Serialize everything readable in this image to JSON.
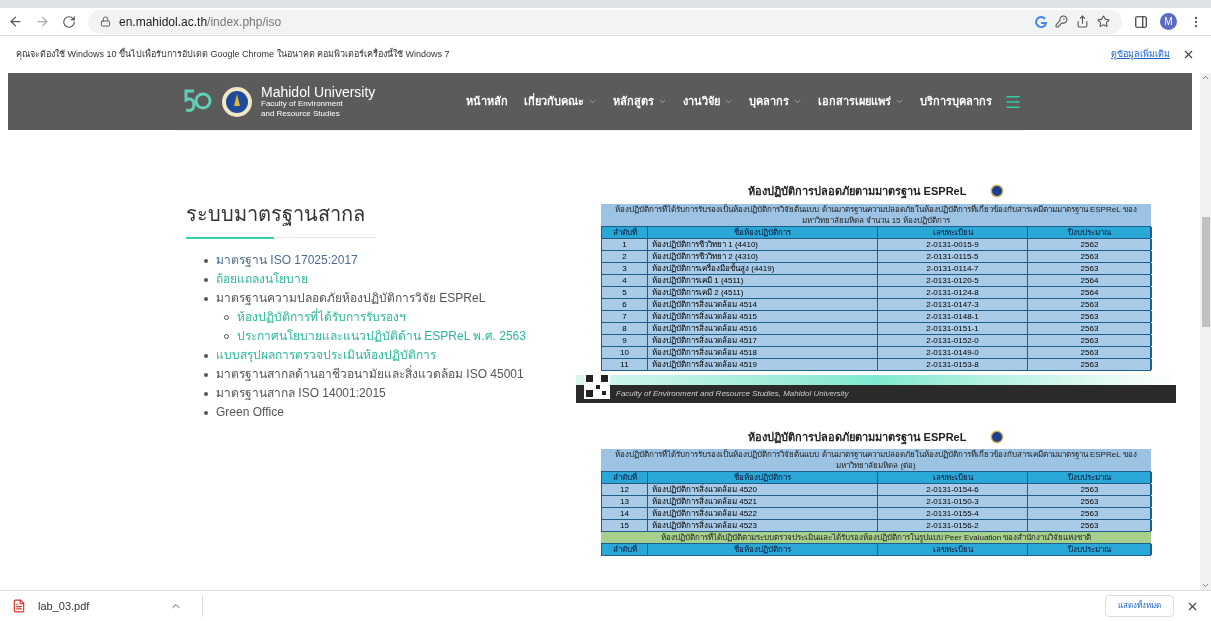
{
  "browser": {
    "url_host": "en.mahidol.ac.th",
    "url_path": "/index.php/iso",
    "profile_initial": "M"
  },
  "infobar": {
    "message": "คุณจะต้องใช้ Windows 10 ขึ้นไปเพื่อรับการอัปเดต Google Chrome ในอนาคต คอมพิวเตอร์เครื่องนี้ใช้ Windows 7",
    "link": "ดูข้อมูลเพิ่มเติม"
  },
  "site_nav": {
    "brand_title": "Mahidol University",
    "brand_subtitle": [
      "Faculty of Environment",
      "and Resource Studies"
    ],
    "items": [
      {
        "label": "หน้าหลัก",
        "has_dropdown": false
      },
      {
        "label": "เกี่ยวกับคณะ",
        "has_dropdown": true
      },
      {
        "label": "หลักสูตร",
        "has_dropdown": true
      },
      {
        "label": "งานวิจัย",
        "has_dropdown": true
      },
      {
        "label": "บุคลากร",
        "has_dropdown": true
      },
      {
        "label": "เอกสารเผยแพร่",
        "has_dropdown": true
      },
      {
        "label": "บริการบุคลากร",
        "has_dropdown": false
      }
    ]
  },
  "content": {
    "heading": "ระบบมาตรฐานสากล",
    "items": [
      {
        "text": "มาตรฐาน ISO 17025:2017",
        "kind": "visited"
      },
      {
        "text": "ถ้อยแถลงนโยบาย",
        "kind": "link"
      },
      {
        "text": "มาตรฐานความปลอดภัยห้องปฏิบัติการวิจัย ESPReL",
        "kind": "text",
        "children": [
          {
            "text": "ห้องปฏิบัติการที่ได้รับการรับรองฯ",
            "kind": "link"
          },
          {
            "text": "ประกาศนโยบายและแนวปฏิบัติด้าน ESPReL พ.ศ. 2563",
            "kind": "link"
          }
        ]
      },
      {
        "text": "แบบสรุปผลการตรวจประเมินห้องปฏิบัติการ",
        "kind": "link"
      },
      {
        "text": "มาตรฐานสากลด้านอาชีวอนามัยและสิ่งแวดล้อม ISO 45001",
        "kind": "text"
      },
      {
        "text": "มาตรฐานสากล ISO 14001:2015",
        "kind": "text"
      },
      {
        "text": "Green Office",
        "kind": "text"
      }
    ]
  },
  "posters": [
    {
      "title": "ห้องปฏิบัติการปลอดภัยตามมาตรฐาน ESPReL",
      "caption": "ห้องปฏิบัติการที่ได้รับการรับรองเป็นห้องปฏิบัติการวิจัยต้นแบบ ด้านมาตรฐานความปลอดภัยในห้องปฏิบัติการที่เกี่ยวข้องกับสารเคมีตามมาตรฐาน ESPReL ของมหาวิทยาลัยมหิดล จำนวน 15 ห้องปฏิบัติการ",
      "columns": [
        "ลำดับที่",
        "ชื่อห้องปฏิบัติการ",
        "เลขทะเบียน",
        "ปีงบประมาณ"
      ],
      "rows": [
        [
          "1",
          "ห้องปฏิบัติการชีววิทยา 1 (4410)",
          "2-0131-0015-9",
          "2562"
        ],
        [
          "2",
          "ห้องปฏิบัติการชีววิทยา 2 (4310)",
          "2-0131-0115-5",
          "2563"
        ],
        [
          "3",
          "ห้องปฏิบัติการเครื่องมือขั้นสูง (4419)",
          "2-0131-0114-7",
          "2563"
        ],
        [
          "4",
          "ห้องปฏิบัติการเคมี 1 (4511)",
          "2-0131-0120-5",
          "2564"
        ],
        [
          "5",
          "ห้องปฏิบัติการเคมี 2 (4511)",
          "2-0131-0124-8",
          "2564"
        ],
        [
          "6",
          "ห้องปฏิบัติการสิ่งแวดล้อม 4514",
          "2-0131-0147-3",
          "2563"
        ],
        [
          "7",
          "ห้องปฏิบัติการสิ่งแวดล้อม 4515",
          "2-0131-0148-1",
          "2563"
        ],
        [
          "8",
          "ห้องปฏิบัติการสิ่งแวดล้อม 4516",
          "2-0131-0151-1",
          "2563"
        ],
        [
          "9",
          "ห้องปฏิบัติการสิ่งแวดล้อม 4517",
          "2-0131-0152-0",
          "2563"
        ],
        [
          "10",
          "ห้องปฏิบัติการสิ่งแวดล้อม 4518",
          "2-0131-0149-0",
          "2563"
        ],
        [
          "11",
          "ห้องปฏิบัติการสิ่งแวดล้อม 4519",
          "2-0131-0153-8",
          "2563"
        ]
      ],
      "footer": "Faculty of Environment and Resource Studies, Mahidol University"
    },
    {
      "title": "ห้องปฏิบัติการปลอดภัยตามมาตรฐาน ESPReL",
      "caption": "ห้องปฏิบัติการที่ได้รับการรับรองเป็นห้องปฏิบัติการวิจัยต้นแบบ ด้านมาตรฐานความปลอดภัยในห้องปฏิบัติการที่เกี่ยวข้องกับสารเคมีตามมาตรฐาน ESPReL ของมหาวิทยาลัยมหิดล (ต่อ)",
      "columns": [
        "ลำดับที่",
        "ชื่อห้องปฏิบัติการ",
        "เลขทะเบียน",
        "ปีงบประมาณ"
      ],
      "rows": [
        [
          "12",
          "ห้องปฏิบัติการสิ่งแวดล้อม 4520",
          "2-0131-0154-6",
          "2563"
        ],
        [
          "13",
          "ห้องปฏิบัติการสิ่งแวดล้อม 4521",
          "2-0131-0150-3",
          "2563"
        ],
        [
          "14",
          "ห้องปฏิบัติการสิ่งแวดล้อม 4522",
          "2-0131-0155-4",
          "2563"
        ],
        [
          "15",
          "ห้องปฏิบัติการสิ่งแวดล้อม 4523",
          "2-0131-0156-2",
          "2563"
        ]
      ],
      "section": {
        "caption": "ห้องปฏิบัติการที่ได้ปฏิบัติตามระบบตรวจประเมินและได้รับรองห้องปฏิบัติการในรูปแบบ Peer Evaluation ของสำนักงานวิจัยแห่งชาติ",
        "columns": [
          "ลำดับที่",
          "ชื่อห้องปฏิบัติการ",
          "เลขทะเบียน",
          "ปีงบประมาณ"
        ]
      }
    }
  ],
  "downloads": {
    "file": "lab_03.pdf",
    "show_all": "แสดงทั้งหมด"
  }
}
